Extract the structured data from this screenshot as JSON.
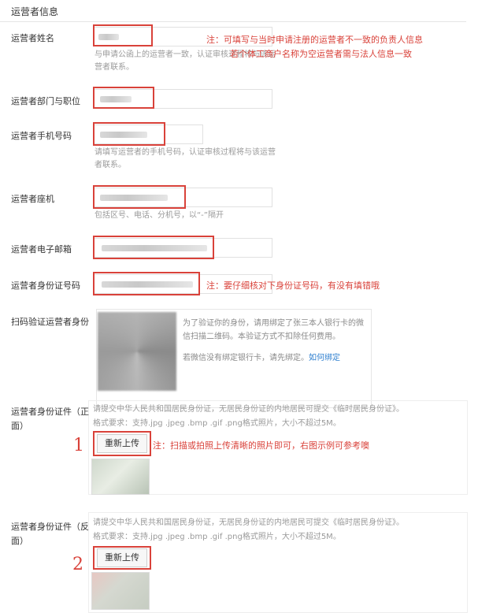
{
  "section_title": "运营者信息",
  "fields": {
    "name": {
      "label": "运营者姓名",
      "hint": "与申请公函上的运营者一致，认证审核过程将与该运营者联系。",
      "note_line1": "注：可填写与当时申请注册的运营者不一致的负责人信息",
      "note_line2": "若个体工商户名称为空运营者需与法人信息一致"
    },
    "dept": {
      "label": "运营者部门与职位"
    },
    "mobile": {
      "label": "运营者手机号码",
      "hint": "请填写运营者的手机号码，认证审核过程将与该运营者联系。"
    },
    "phone": {
      "label": "运营者座机",
      "hint": "包括区号、电话、分机号，以“-”隔开"
    },
    "email": {
      "label": "运营者电子邮箱"
    },
    "idnum": {
      "label": "运营者身份证号码",
      "note": "注：要仔细核对下身份证号码，有没有填错哦"
    }
  },
  "qr": {
    "label": "扫码验证运营者身份",
    "text": "为了验证你的身份，请用绑定了张三本人银行卡的微信扫描二维码。本验证方式不扣除任何费用。",
    "unbound": "若微信没有绑定银行卡，请先绑定。",
    "link": "如何绑定"
  },
  "id_front": {
    "label_line1": "运营者身份证件（正",
    "label_line2": "面）",
    "hint_line1": "请提交中华人民共和国居民身份证，无居民身份证的内地居民可提交《临时居民身份证》。",
    "hint_line2": "格式要求：支持.jpg .jpeg .bmp .gif .png格式照片，大小不超过5M。",
    "button": "重新上传",
    "marker": "1",
    "note": "注：扫描或拍照上传清晰的照片即可，右图示例可参考噢"
  },
  "id_back": {
    "label_line1": "运营者身份证件（反",
    "label_line2": "面）",
    "hint_line1": "请提交中华人民共和国居民身份证，无居民身份证的内地居民可提交《临时居民身份证》。",
    "hint_line2": "格式要求：支持.jpg .jpeg .bmp .gif .png格式照片，大小不超过5M。",
    "button": "重新上传",
    "marker": "2"
  },
  "colors": {
    "annotation_red": "#d9423a",
    "link_blue": "#2f7fcf",
    "hint_gray": "#9a9a9a"
  }
}
